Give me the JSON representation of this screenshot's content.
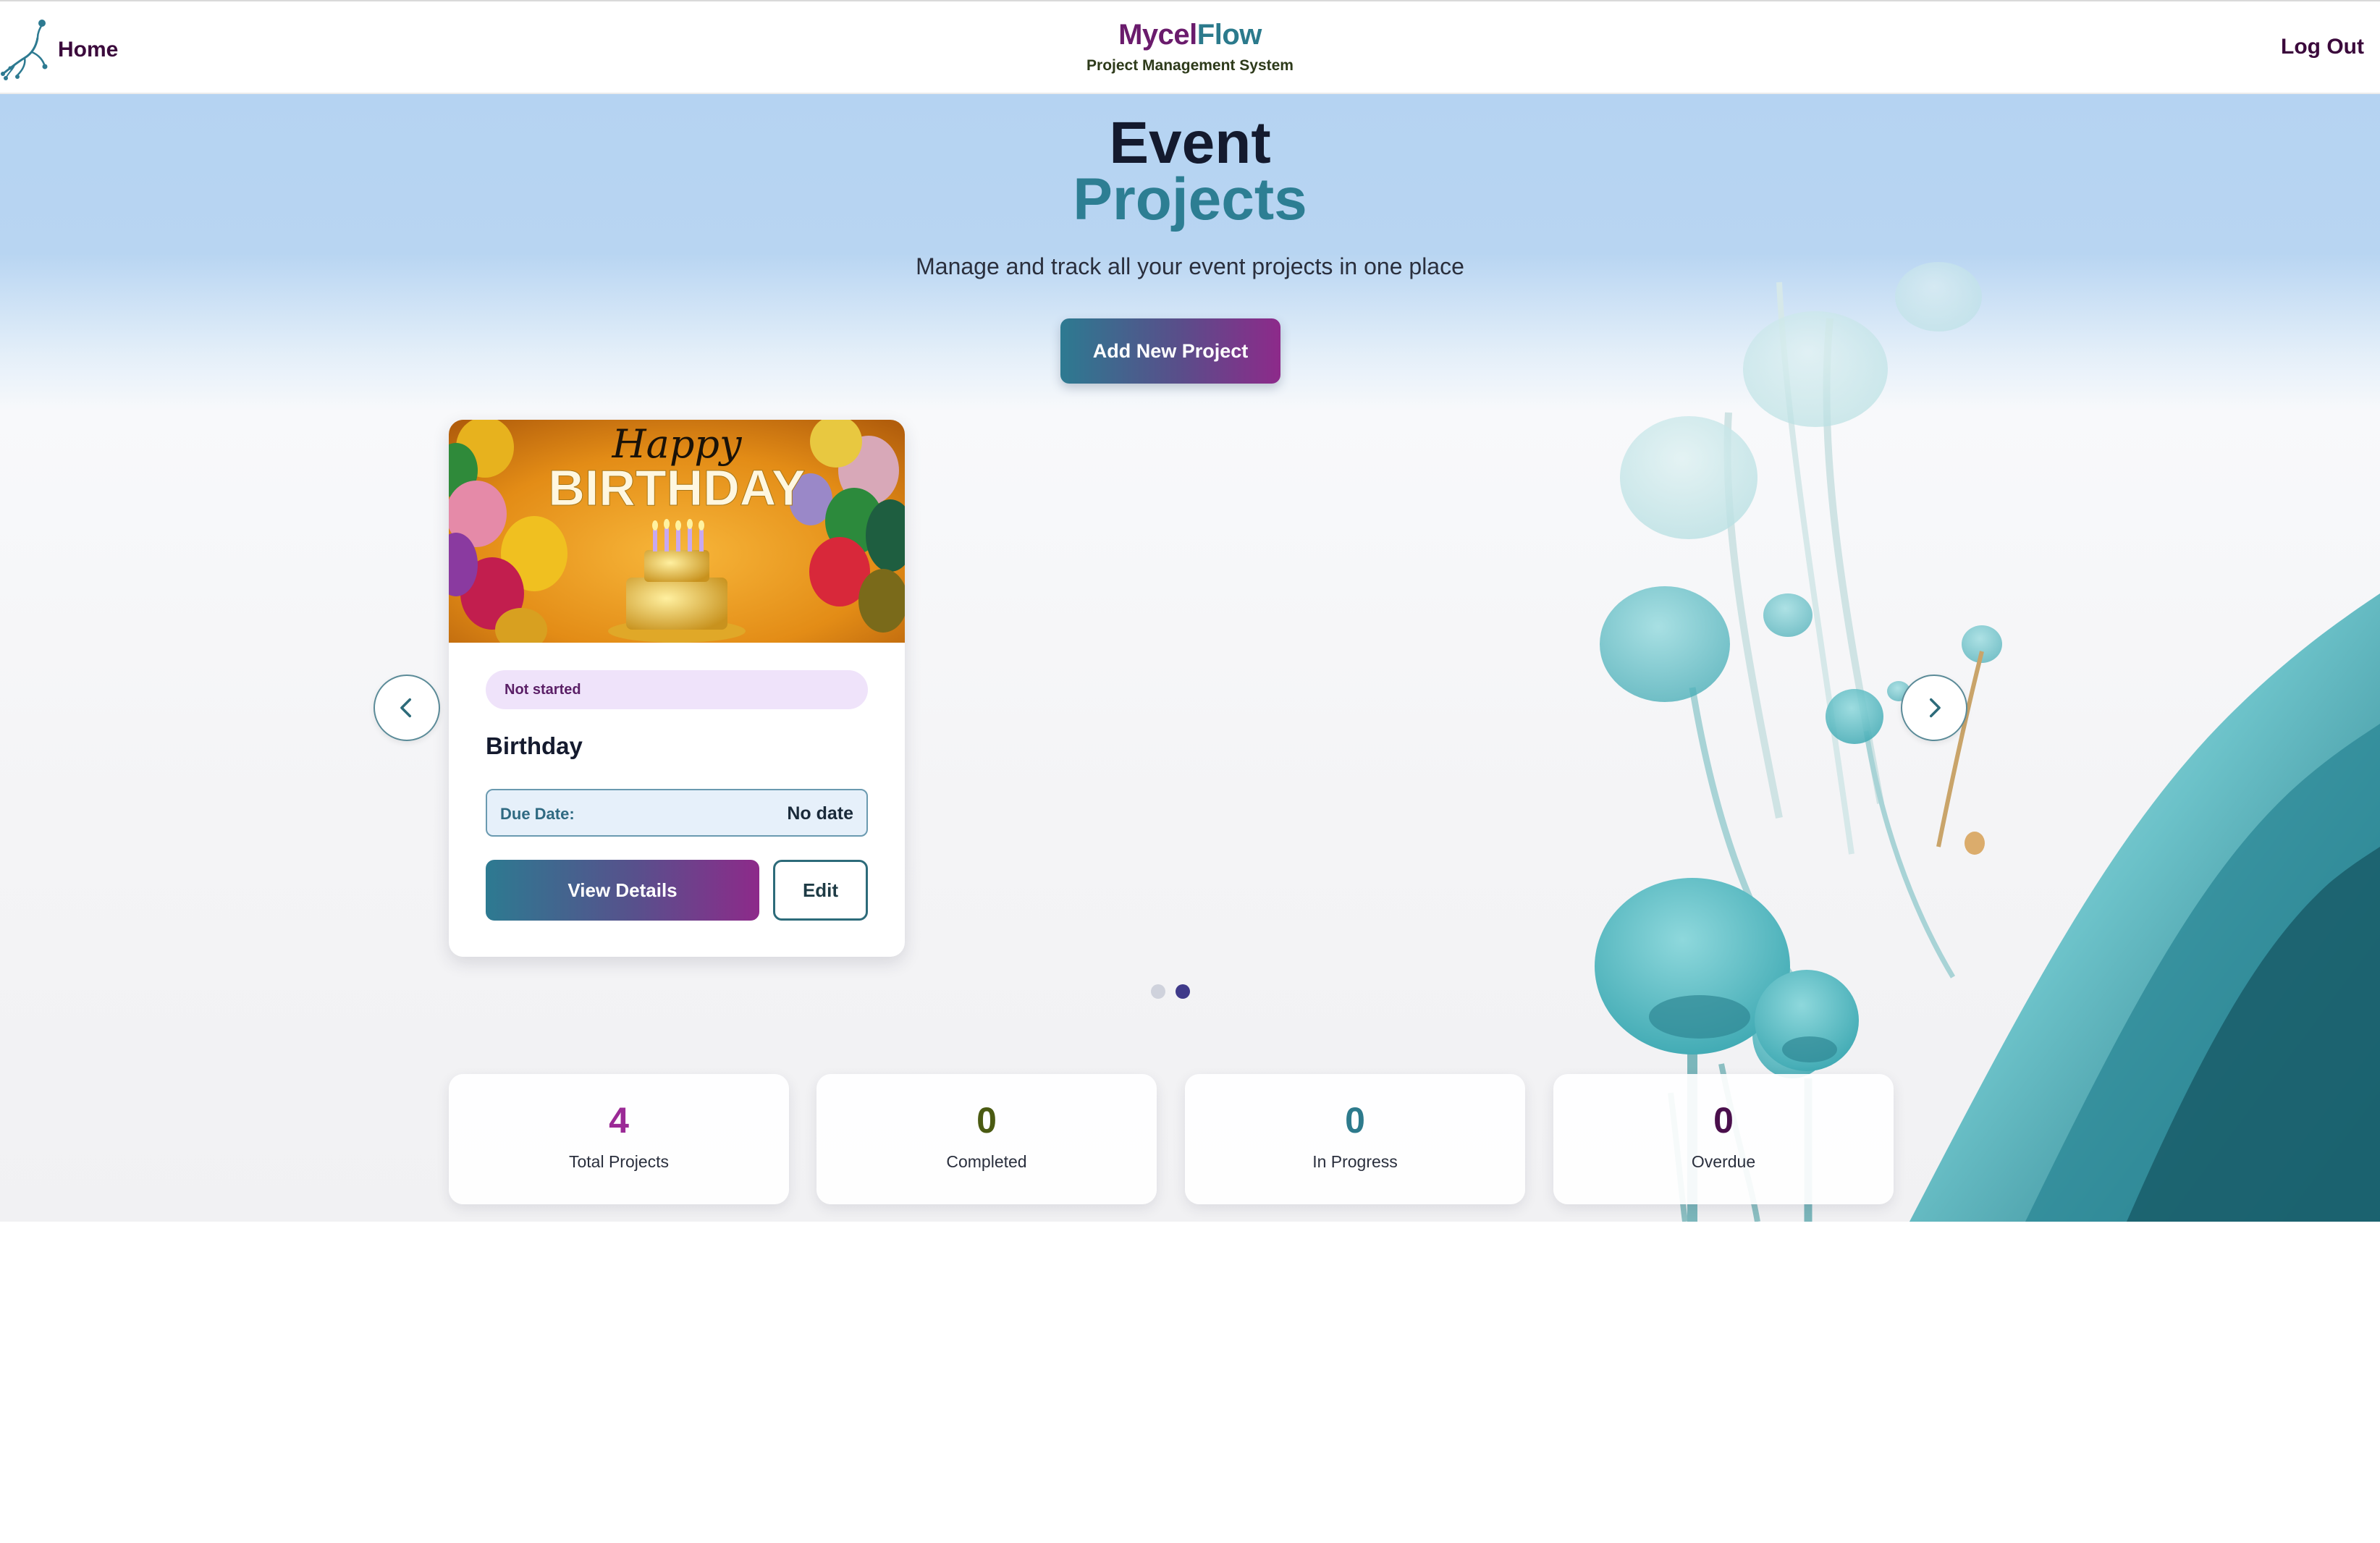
{
  "header": {
    "home_label": "Home",
    "brand_part1": "Mycel",
    "brand_part2": "Flow",
    "brand_subtitle": "Project Management System",
    "logout_label": "Log Out"
  },
  "hero": {
    "title_line1": "Event",
    "title_line2": "Projects",
    "subtitle": "Manage and track all your event projects in one place",
    "add_button": "Add New Project"
  },
  "carousel": {
    "prev_icon": "chevron-left-icon",
    "next_icon": "chevron-right-icon",
    "active_page": 2,
    "page_count": 2,
    "card": {
      "image": "birthday-cake-balloons",
      "image_text_script": "Happy",
      "image_text_main": "BIRTHDAY",
      "status": "Not started",
      "title": "Birthday",
      "due_label": "Due Date:",
      "due_value": "No date",
      "view_button": "View Details",
      "edit_button": "Edit"
    }
  },
  "stats": [
    {
      "value": "4",
      "label": "Total Projects",
      "color": "#9b2a96"
    },
    {
      "value": "0",
      "label": "Completed",
      "color": "#4a5a12"
    },
    {
      "value": "0",
      "label": "In Progress",
      "color": "#2d7a8c"
    },
    {
      "value": "0",
      "label": "Overdue",
      "color": "#4a0f4c"
    }
  ],
  "colors": {
    "accent_teal": "#2d7a91",
    "accent_purple": "#8d2a8a",
    "brand_purple": "#6a1b6c",
    "brand_teal": "#2b7a8c"
  }
}
